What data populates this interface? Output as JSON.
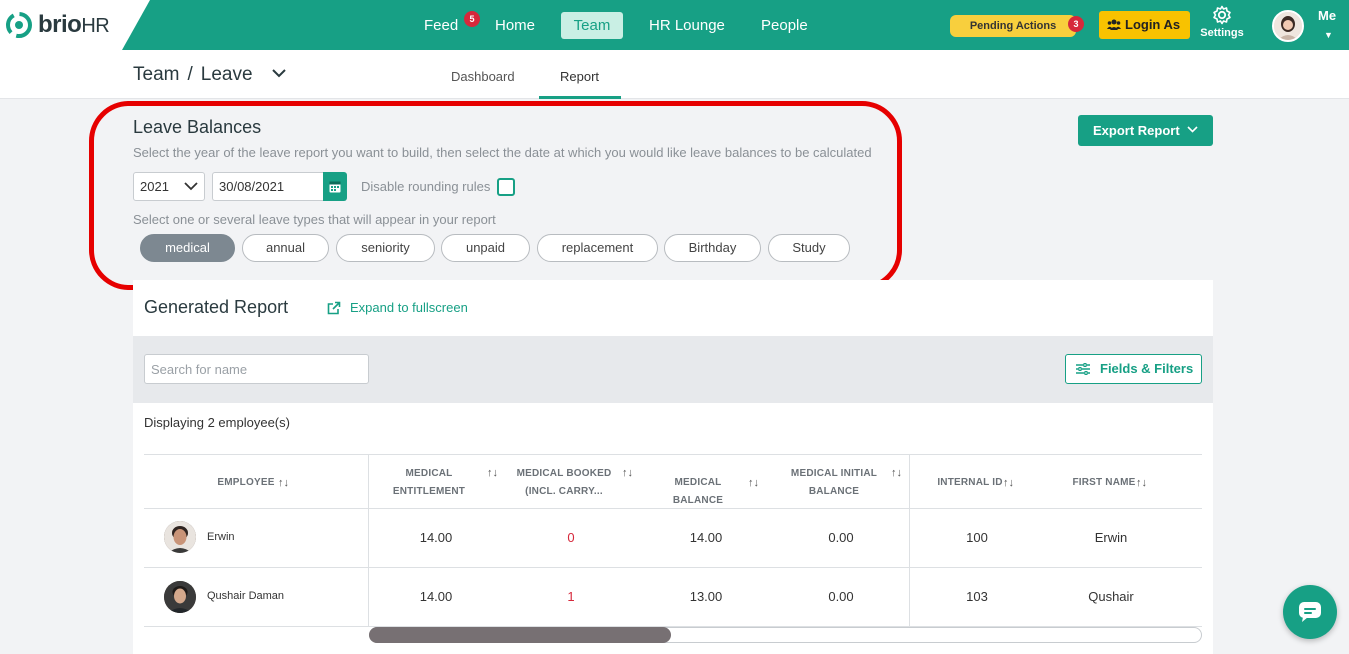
{
  "brand": {
    "name": "brio",
    "suffix": "HR"
  },
  "nav": {
    "items": [
      {
        "label": "Feed",
        "badge": "5"
      },
      {
        "label": "Home"
      },
      {
        "label": "Team",
        "active": true
      },
      {
        "label": "HR Lounge"
      },
      {
        "label": "People"
      }
    ],
    "pending_actions": {
      "label": "Pending Actions",
      "badge": "3"
    },
    "login_as": "Login As",
    "settings": "Settings",
    "me": "Me"
  },
  "breadcrumb": {
    "section": "Team",
    "separator": "/",
    "page": "Leave"
  },
  "subtabs": [
    {
      "label": "Dashboard"
    },
    {
      "label": "Report",
      "active": true
    }
  ],
  "leave_balances": {
    "title": "Leave Balances",
    "description": "Select the year of the leave report you want to build, then select the date at which you would like leave balances to be calculated",
    "year": "2021",
    "date": "30/08/2021",
    "rounding_label": "Disable rounding rules",
    "rounding_checked": false,
    "types_label": "Select one or several leave types that will appear in your report",
    "types": [
      {
        "label": "medical",
        "selected": true
      },
      {
        "label": "annual"
      },
      {
        "label": "seniority"
      },
      {
        "label": "unpaid"
      },
      {
        "label": "replacement"
      },
      {
        "label": "Birthday"
      },
      {
        "label": "Study"
      }
    ]
  },
  "export_button": "Export Report",
  "report": {
    "title": "Generated Report",
    "expand_label": "Expand to fullscreen",
    "search_placeholder": "Search for name",
    "filters_label": "Fields & Filters",
    "displaying": "Displaying 2 employee(s)",
    "columns": [
      {
        "line1": "EMPLOYEE",
        "line2": ""
      },
      {
        "line1": "MEDICAL",
        "line2": "ENTITLEMENT"
      },
      {
        "line1": "MEDICAL BOOKED",
        "line2": "(INCL. CARRY..."
      },
      {
        "line1": "MEDICAL BALANCE",
        "line2": ""
      },
      {
        "line1": "MEDICAL INITIAL",
        "line2": "BALANCE"
      },
      {
        "line1": "INTERNAL ID",
        "line2": ""
      },
      {
        "line1": "FIRST NAME",
        "line2": ""
      }
    ],
    "sort_glyph": "↑↓",
    "rows": [
      {
        "employee": "Erwin",
        "entitlement": "14.00",
        "booked": "0",
        "balance": "14.00",
        "initial": "0.00",
        "internal_id": "100",
        "first_name": "Erwin"
      },
      {
        "employee": "Qushair Daman",
        "entitlement": "14.00",
        "booked": "1",
        "balance": "13.00",
        "initial": "0.00",
        "internal_id": "103",
        "first_name": "Qushair"
      }
    ]
  },
  "colors": {
    "brand": "#17a085",
    "alert": "#d6283b",
    "highlight": "#e60000"
  }
}
